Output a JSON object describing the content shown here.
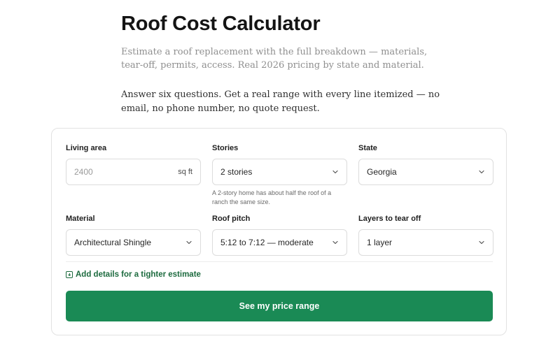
{
  "header": {
    "title": "Roof Cost Calculator",
    "subtitle": "Estimate a roof replacement with the full breakdown — materials, tear-off, permits, access. Real 2026 pricing by state and material.",
    "intro": "Answer six questions. Get a real range with every line itemized — no email, no phone number, no quote request."
  },
  "form": {
    "living_area": {
      "label": "Living area",
      "placeholder": "2400",
      "suffix": "sq ft"
    },
    "stories": {
      "label": "Stories",
      "value": "2 stories",
      "hint": "A 2-story home has about half the roof of a ranch the same size."
    },
    "state": {
      "label": "State",
      "value": "Georgia"
    },
    "material": {
      "label": "Material",
      "value": "Architectural Shingle"
    },
    "roof_pitch": {
      "label": "Roof pitch",
      "value": "5:12 to 7:12 — moderate"
    },
    "layers": {
      "label": "Layers to tear off",
      "value": "1 layer"
    },
    "details_link": "Add details for a tighter estimate",
    "submit": "See my price range"
  },
  "colors": {
    "accent": "#1a8a55",
    "link": "#1d6b3f"
  },
  "icons": {
    "select": "chevron-down-icon",
    "details": "plus-square-icon"
  }
}
